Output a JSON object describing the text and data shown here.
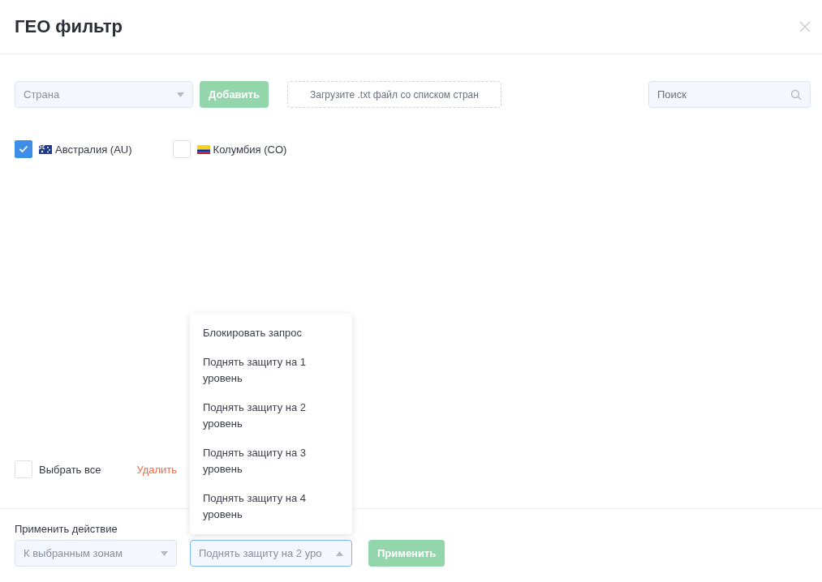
{
  "window": {
    "title": "ГЕО фильтр"
  },
  "toolbar": {
    "country_select": {
      "placeholder": "Страна"
    },
    "add_button": "Добавить",
    "upload_zone": "Загрузите .txt файл со списком стран",
    "search": {
      "placeholder": "Поиск"
    }
  },
  "countries": [
    {
      "label": "Австралия (AU)",
      "kind": "au",
      "checked": true
    },
    {
      "label": "Колумбия (CO)",
      "kind": "co",
      "checked": false
    }
  ],
  "bulk": {
    "select_all": {
      "label": "Выбрать все",
      "checked": false
    },
    "delete_link": "Удалить"
  },
  "footer": {
    "label": "Применить действие",
    "scope_select": {
      "value": "К выбранным зонам"
    },
    "action_select": {
      "value": "Поднять защиту на 2 уро",
      "open": true,
      "options": [
        "Блокировать запрос",
        "Поднять защиту на 1 уровень",
        "Поднять защиту на 2 уровень",
        "Поднять защиту на 3 уровень",
        "Поднять защиту на 4 уровень"
      ]
    },
    "apply_button": "Применить"
  }
}
